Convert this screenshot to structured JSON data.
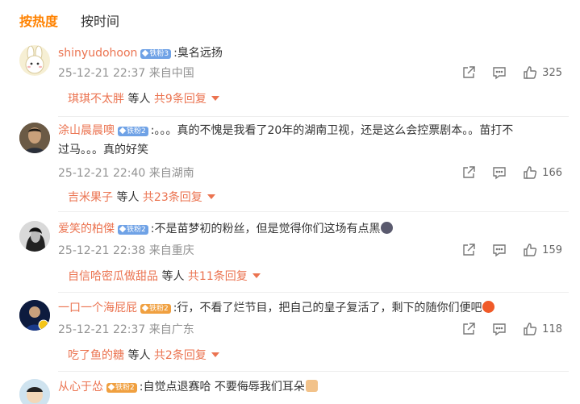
{
  "tabs": {
    "hot": "按热度",
    "time": "按时间"
  },
  "comments": [
    {
      "user": "shinyudohoon",
      "badge": "铁粉3",
      "text": ":臭名远扬",
      "time": "25-12-21 22:37 来自中国",
      "likes": "325",
      "reply_user": "琪琪不太胖",
      "reply_etc": "等人",
      "reply_total": "共9条回复"
    },
    {
      "user": "涂山晨晨噢",
      "badge": "铁粉2",
      "text": ":。。。真的不愧是我看了20年的湖南卫视，还是这么会控票剧本。。苗打不",
      "text2": "过马。。。真的好笑",
      "time": "25-12-21 22:40 来自湖南",
      "likes": "166",
      "reply_user": "吉米果子",
      "reply_etc": "等人",
      "reply_total": "共23条回复"
    },
    {
      "user": "爱笑的柏傑",
      "badge": "铁粉2",
      "text": ":不是苗梦初的粉丝，但是觉得你们这场有点黑",
      "time": "25-12-21 22:38 来自重庆",
      "likes": "159",
      "reply_user": "自信哈密瓜做甜品",
      "reply_etc": "等人",
      "reply_total": "共11条回复"
    },
    {
      "user": "一口一个海屁屁",
      "badge": "铁粉2",
      "text": ":行，不看了烂节目，把自己的皇子复活了，剩下的随你们便吧",
      "time": "25-12-21 22:37 来自广东",
      "likes": "118",
      "reply_user": "吃了鱼的糖",
      "reply_etc": "等人",
      "reply_total": "共2条回复"
    },
    {
      "user": "从心于怂",
      "badge": "铁粉2",
      "text": ":自觉点退赛哈 不要侮辱我们耳朵"
    }
  ],
  "icons": {
    "share": "share-icon",
    "comment": "comment-icon",
    "like": "thumbs-up-icon"
  },
  "colors": {
    "accent": "#ff8200",
    "username": "#eb7350",
    "badge": "#6fa2e6",
    "meta": "#939393"
  }
}
